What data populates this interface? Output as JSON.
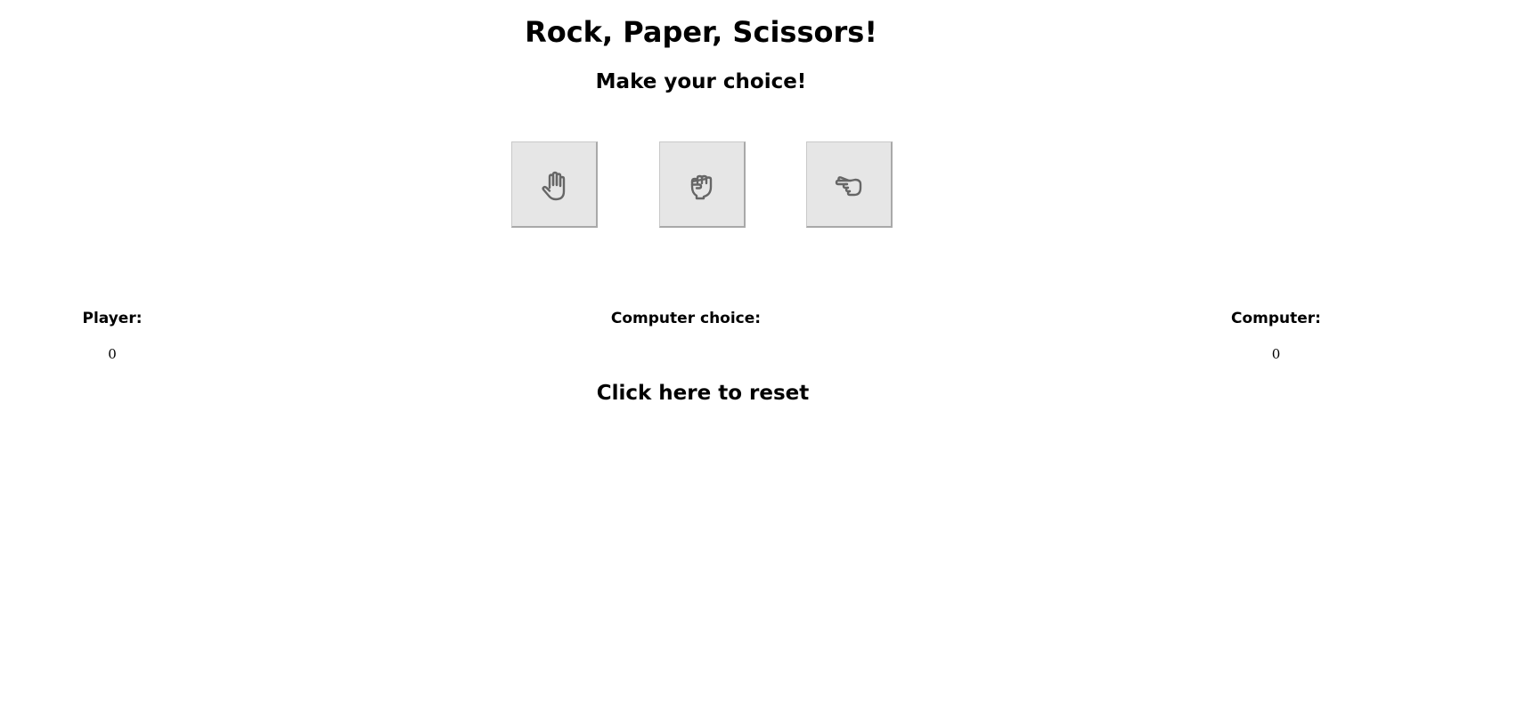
{
  "header": {
    "title": "Rock, Paper, Scissors!",
    "subtitle": "Make your choice!"
  },
  "choices": [
    {
      "id": "paper",
      "icon": "hand-paper-icon"
    },
    {
      "id": "rock",
      "icon": "hand-rock-icon"
    },
    {
      "id": "scissors",
      "icon": "hand-scissors-icon"
    }
  ],
  "colors": {
    "button_background": "#e6e6e6",
    "icon_stroke": "#666666"
  },
  "scoreboard": {
    "player_label": "Player:",
    "player_score": "0",
    "computer_choice_label": "Computer choice:",
    "computer_label": "Computer:",
    "computer_score": "0"
  },
  "reset_label": "Click here to reset"
}
